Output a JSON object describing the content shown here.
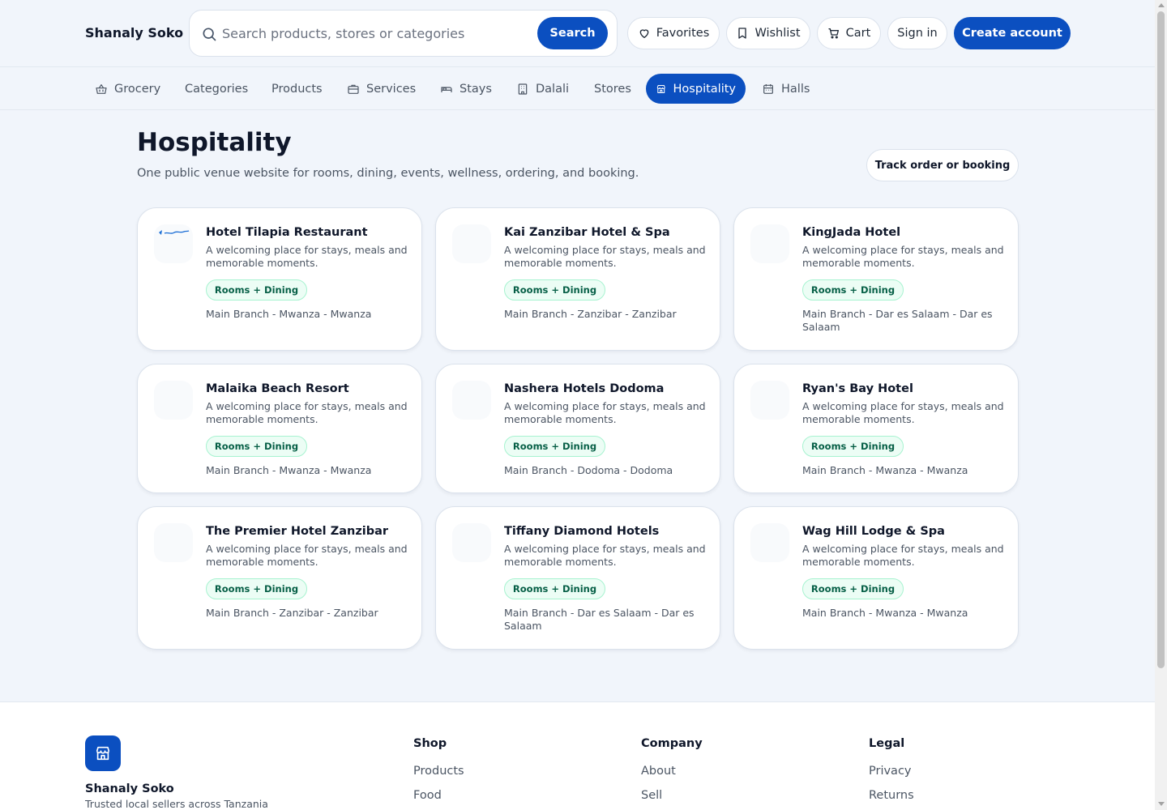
{
  "header": {
    "brand": "Shanaly Soko",
    "search_placeholder": "Search products, stores or categories",
    "search_button": "Search",
    "favorites": "Favorites",
    "wishlist": "Wishlist",
    "cart": "Cart",
    "sign_in": "Sign in",
    "create_account": "Create account"
  },
  "nav": {
    "items": [
      "Grocery",
      "Categories",
      "Products",
      "Services",
      "Stays",
      "Dalali",
      "Stores",
      "Hospitality",
      "Halls"
    ],
    "active": "Hospitality"
  },
  "main": {
    "title": "Hospitality",
    "subtitle": "One public venue website for rooms, dining, events, wellness, ordering, and booking.",
    "track_button": "Track order or booking"
  },
  "venues": [
    {
      "name": "Hotel Tilapia Restaurant",
      "description": "A welcoming place for stays, meals and memorable moments.",
      "badge": "Rooms + Dining",
      "location": "Main Branch - Mwanza - Mwanza"
    },
    {
      "name": "Kai Zanzibar Hotel & Spa",
      "description": "A welcoming place for stays, meals and memorable moments.",
      "badge": "Rooms + Dining",
      "location": "Main Branch - Zanzibar - Zanzibar"
    },
    {
      "name": "KingJada Hotel",
      "description": "A welcoming place for stays, meals and memorable moments.",
      "badge": "Rooms + Dining",
      "location": "Main Branch - Dar es Salaam - Dar es Salaam"
    },
    {
      "name": "Malaika Beach Resort",
      "description": "A welcoming place for stays, meals and memorable moments.",
      "badge": "Rooms + Dining",
      "location": "Main Branch - Mwanza - Mwanza"
    },
    {
      "name": "Nashera Hotels Dodoma",
      "description": "A welcoming place for stays, meals and memorable moments.",
      "badge": "Rooms + Dining",
      "location": "Main Branch - Dodoma - Dodoma"
    },
    {
      "name": "Ryan's Bay Hotel",
      "description": "A welcoming place for stays, meals and memorable moments.",
      "badge": "Rooms + Dining",
      "location": "Main Branch - Mwanza - Mwanza"
    },
    {
      "name": "The Premier Hotel Zanzibar",
      "description": "A welcoming place for stays, meals and memorable moments.",
      "badge": "Rooms + Dining",
      "location": "Main Branch - Zanzibar - Zanzibar"
    },
    {
      "name": "Tiffany Diamond Hotels",
      "description": "A welcoming place for stays, meals and memorable moments.",
      "badge": "Rooms + Dining",
      "location": "Main Branch - Dar es Salaam - Dar es Salaam"
    },
    {
      "name": "Wag Hill Lodge & Spa",
      "description": "A welcoming place for stays, meals and memorable moments.",
      "badge": "Rooms + Dining",
      "location": "Main Branch - Mwanza - Mwanza"
    }
  ],
  "footer": {
    "brand": "Shanaly Soko",
    "tagline": "Trusted local sellers across Tanzania",
    "columns": [
      {
        "heading": "Shop",
        "links": [
          "Products",
          "Food"
        ]
      },
      {
        "heading": "Company",
        "links": [
          "About",
          "Sell"
        ]
      },
      {
        "heading": "Legal",
        "links": [
          "Privacy",
          "Returns"
        ]
      }
    ]
  },
  "colors": {
    "accent": "#0b4fc0",
    "background": "#f1f5fb",
    "badge_bg": "#ecfdf5",
    "badge_text": "#065f46"
  },
  "icons": {
    "search": "search-icon",
    "favorites": "heart-icon",
    "wishlist": "bookmark-icon",
    "cart": "cart-icon",
    "grocery": "basket-icon",
    "services": "briefcase-icon",
    "stays": "bed-icon",
    "dalali": "building-icon",
    "hospitality": "store-icon",
    "halls": "calendar-icon"
  }
}
